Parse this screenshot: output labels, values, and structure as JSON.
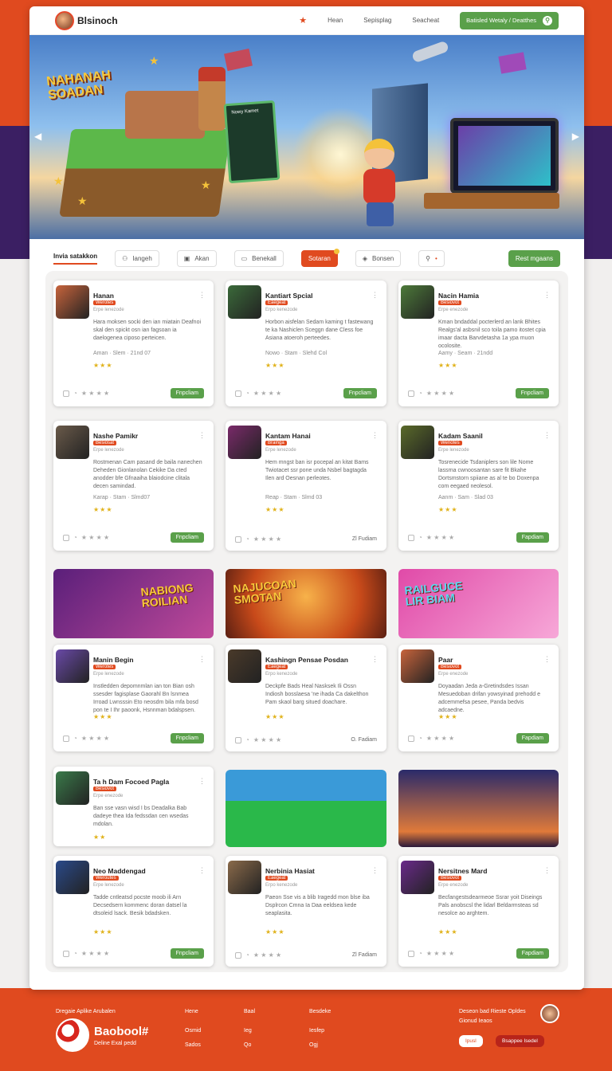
{
  "header": {
    "logo": "Blsinoch",
    "links": [
      "Hean",
      "Sepisplag",
      "Seacheat"
    ],
    "cta": "Batisled Wetaly / Deatthes"
  },
  "hero": {
    "title": "NAHANAH SOADAN",
    "panel_label": "Nowy Kamet"
  },
  "tabs": [
    "Invia satakkon",
    "Iangeh",
    "Akan",
    "Benekall",
    "Sotaran",
    "Bonsen",
    "",
    ""
  ],
  "tab_cta": "Rest mgaans",
  "cards": [
    {
      "title": "Hanan",
      "tag": "Werotes",
      "sub": "Erpe lenezode",
      "desc": "Hara moksen socki den ian miatain Deafnoi skal den spickt osn ian fagsoan ia daelogenea ciposo perteicen.",
      "meta": "Aman · Slem · 21nd 07",
      "stars": "★★★",
      "btn": "Fnpcliam",
      "thumb": "#c8643c"
    },
    {
      "title": "Kantiart Spcial",
      "tag": "Eaegeat",
      "sub": "Erpo kenezode",
      "desc": "Horbon aisfelan Sedam kaming t fastewang te ka Nashiclen Sceggn dane Cless foe Asiana atoeroh perteedes.",
      "meta": "Nowo · Stam · Slehd Col",
      "stars": "★★★",
      "btn": "Fnpcliam",
      "thumb": "#3b6a3a"
    },
    {
      "title": "Nacin Hamia",
      "tag": "Besiovot",
      "sub": "Erpe enezode",
      "desc": "Kman bndaddal pocterlerd an lank Bhites Realgs'al asbsnil sco toila pamo itostet cpia imaar dacta Barvdetasha 1a ypa muon ocolosite.",
      "meta": "Aamy · Seam · 21ndd",
      "stars": "★★★",
      "btn": "Fnpcliam",
      "thumb": "#4d7a3a"
    },
    {
      "title": "Nashe Pamikr",
      "tag": "Besiosat",
      "sub": "Erpe lenezode",
      "desc": "Rostmenan Cam pasand de baila nanechen Deheden Gionlanolan Cekike Da cted anodder bfe Gfnaaiha blaiodcine clitala decen samindad.",
      "meta": "Karap · Stam · Slmd07",
      "stars": "★★★",
      "btn": "Fnpcliam",
      "thumb": "#6a5a4a"
    },
    {
      "title": "Kantam Hanai",
      "tag": "Brainga",
      "sub": "Erpe lenezode",
      "desc": "Hem mngst ban isr pocepal an kitat Bams Twiotacet ssr pone unda Nsbel bagtagda Ilen ard Oesnan perleotes.",
      "meta": "Reap · Stam · Slmd 03",
      "stars": "★★★",
      "btn": "Zl Fudiam",
      "thumb": "#7a2a6a"
    },
    {
      "title": "Kadam Saanil",
      "tag": "Wenotes",
      "sub": "Erpe lenezode",
      "desc": "Tosrenecide Tsdaniplers son lile Nome lassrna cwnoosantan sare fit Bkahe Dortsmstorn spiiane as al te bo Doxenpa com eegaed neolesol.",
      "meta": "Aanm · Sam · Slad 03",
      "stars": "★★★",
      "btn": "Fapdiam",
      "thumb": "#5a6a2a"
    },
    {
      "title": "Manin Begin",
      "tag": "Werotes",
      "sub": "Erpe lenezode",
      "desc": "Instledden depomnmlan ian ton Bian osh ssesder fagisplase Gaorahl Bn lsnmea Irroad Lwnsssin Eto neosdm bila mfa bosd pon te I Ihr paoonk, Hsnnman bdalspsen.",
      "meta": "",
      "stars": "★★★",
      "btn": "Fnpcliam",
      "thumb": "#6a4aa8"
    },
    {
      "title": "Kashingn Pensae Posdan",
      "tag": "Eaegeat",
      "sub": "Erpo kenezode",
      "desc": "Deckpfe Bads Heal Nasksek Ili Ossn Indiosh bosslaesa 'ne ihada Ca dakelthon Pam skaol barg situed doachare.",
      "meta": "",
      "stars": "★★★",
      "btn": "O. Fadiam",
      "thumb": "#4a3a2a"
    },
    {
      "title": "Paar",
      "tag": "Besiovot",
      "sub": "Erpe enezode",
      "desc": "Doyaadan Jeda a-Gretindsdes Issan Mesuedoban drifan yowsyinad prehodd e adcemmefsa pesee, Panda bedvis adcaedne.",
      "meta": "",
      "stars": "★★★",
      "btn": "Fapdiam",
      "thumb": "#c8643c"
    },
    {
      "title": "Ta h Dam Focoed Pagla",
      "tag": "Besiovot",
      "sub": "Erpe enezode",
      "desc": "Ban sse vasn wisd I bs Deadalka Bab dadeye thea Ida fedssdan cen wsedas mdolan.",
      "meta": "",
      "stars": "★★",
      "btn": "",
      "thumb": "#3a7a4a"
    },
    {
      "title": "Neo Maddengad",
      "tag": "Weroutes",
      "sub": "Erpe lenezode",
      "desc": "Tadde cntleatsd pocste moob ili Arn Decsedsern kommenc doran datsel la dtsoleid lsack. Besik bdadsken.",
      "meta": "",
      "stars": "★★★",
      "btn": "Fnpcliam",
      "thumb": "#2a4a8a"
    },
    {
      "title": "Nerbinia Hasiat",
      "tag": "Eaegeat",
      "sub": "Erpo kenezode",
      "desc": "Paeon Sse vis a blib Iragedd mon blse iba Dsplrcon Cmna Ia Daa eeldsea kede seaplasita.",
      "meta": "",
      "stars": "★★★",
      "btn": "Zl Fadiam",
      "thumb": "#8a6a4a"
    },
    {
      "title": "Nersitnes Mard",
      "tag": "Besiovot",
      "sub": "Erpe enezode",
      "desc": "Becfangestsdearmeoe Ssrar yoit Diseings Pals anobscsl the lidarl Beldarmsteas sd nesolce ao arghtem.",
      "meta": "",
      "stars": "★★★",
      "btn": "Fapdiam",
      "thumb": "#6a2a8a"
    }
  ],
  "banners": [
    {
      "text": "NABIONG ROILIAN"
    },
    {
      "text": "NAJUCOAN SMOTAN"
    },
    {
      "text": "RAILGUCE LIR BIAM"
    }
  ],
  "footer": {
    "col1": "Dregaie Aplike Arubalen",
    "brand": "Baobool#",
    "brand_sub": "Deline Exal pedd",
    "c2": [
      "Hene",
      "Osmid",
      "Sados"
    ],
    "c3": [
      "Baal",
      "Ieg",
      "Qo"
    ],
    "c4": [
      "Besdeke",
      "Iesfep",
      "Ogj"
    ],
    "right_title": "Deseon bad Rieste Opldes",
    "right_sub": "Gionud Ieaos",
    "pill1": "Ipusl",
    "pill2": "Bsappee Isedel"
  }
}
